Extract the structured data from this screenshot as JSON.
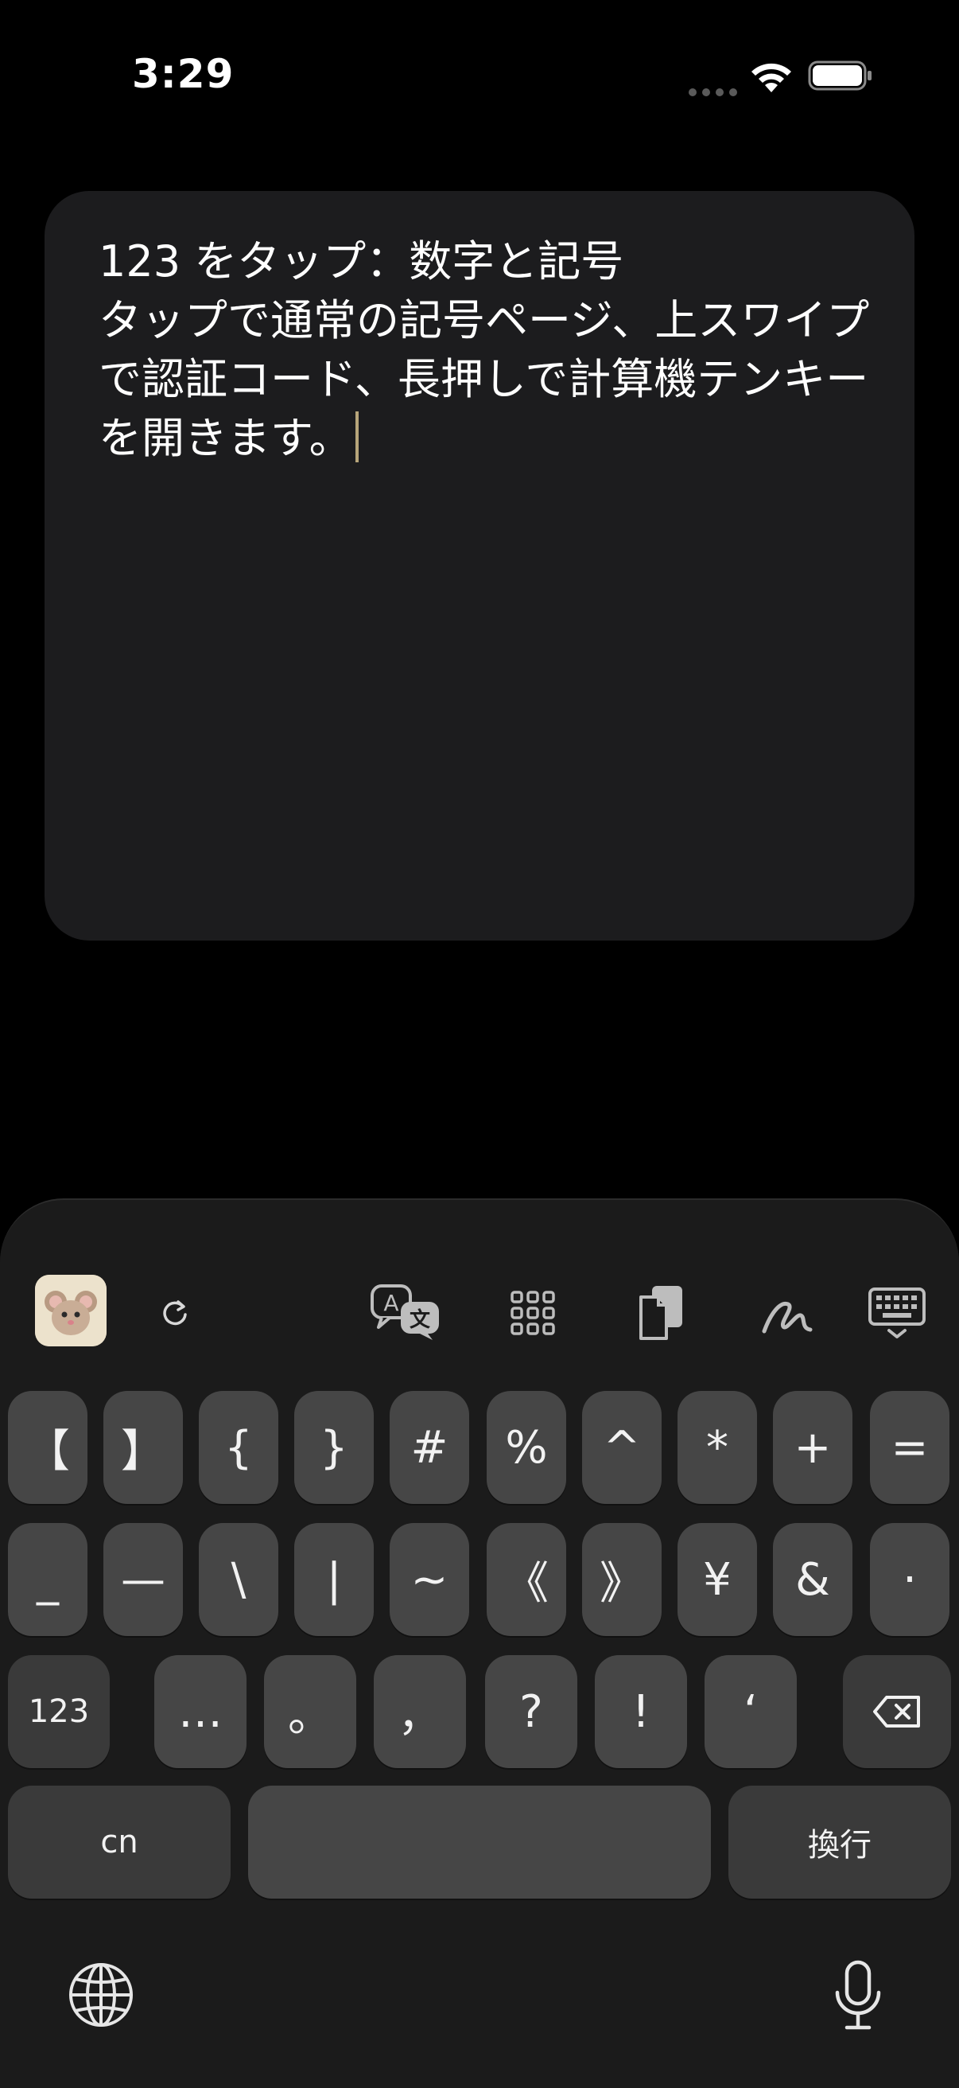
{
  "status_bar": {
    "time": "3:29",
    "icons": [
      "cellular-dots-icon",
      "wifi-icon",
      "battery-icon"
    ]
  },
  "editor": {
    "text": "123 をタップ：数字と記号\nタップで通常の記号ページ、上スワイプで認証コード、長押しで計算機テンキーを開きます。"
  },
  "toolbar": {
    "icons": [
      "app-avatar-icon",
      "refresh-icon",
      "translate-icon",
      "grid-icon",
      "clipboard-icon",
      "handwriting-icon",
      "keyboard-hide-icon"
    ]
  },
  "keyboard": {
    "row1": [
      "【",
      "】",
      "{",
      "}",
      "#",
      "%",
      "^",
      "*",
      "+",
      "="
    ],
    "row2": [
      "_",
      "—",
      "\\",
      "|",
      "~",
      "《",
      "》",
      "¥",
      "&",
      "·"
    ],
    "row3": [
      "123",
      "…",
      "。",
      "，",
      "?",
      "!",
      "‘"
    ],
    "cn_label": "cn",
    "enter_label": "換行",
    "space_label": ""
  },
  "colors": {
    "background": "#000000",
    "card": "#1c1c1e",
    "keyboard_bg": "#1b1b1b",
    "key": "#464646",
    "caret": "#b7a57a"
  }
}
